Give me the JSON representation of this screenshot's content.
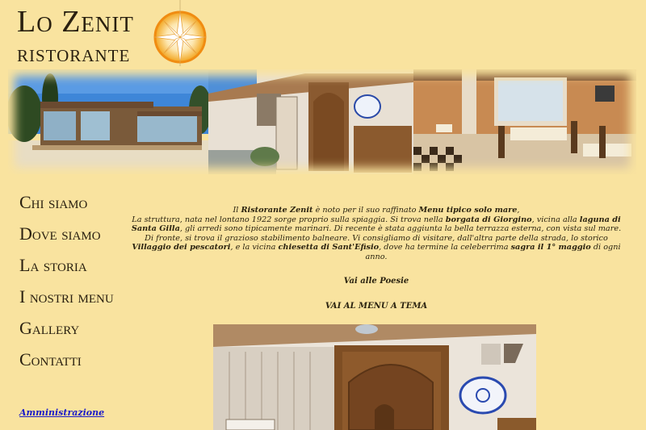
{
  "logo": {
    "line1": "Lo Zenit",
    "line2": "ristorante",
    "compass_icon": "compass-rose-icon"
  },
  "nav": {
    "items": [
      {
        "label": "Chi siamo"
      },
      {
        "label": "Dove siamo"
      },
      {
        "label": "La storia"
      },
      {
        "label": "I nostri menu"
      },
      {
        "label": "Gallery"
      },
      {
        "label": "Contatti"
      }
    ],
    "admin_label": "Amministrazione"
  },
  "content": {
    "p1_a": "Il ",
    "p1_name": "Ristorante Zenit",
    "p1_b": " è noto per il suo raffinato ",
    "p1_menu": "Menu tipico solo mare",
    "p1_c": ",",
    "p2_a": "La struttura, nata nel lontano 1922 sorge proprio sulla spiaggia. Si trova nella ",
    "p2_borgata": "borgata di Giorgino",
    "p2_b": ", vicina alla ",
    "p2_laguna": "laguna di Santa Gilla",
    "p2_c": ", gli arredi sono tipicamente marinari. Di recente è stata aggiunta la bella terrazza esterna, con vista sul mare.",
    "p3_a": "Di fronte, si trova il grazioso stabilimento balneare. Vi consigliamo di visitare, dall'altra parte della strada, lo storico ",
    "p3_villaggio": "Villaggio dei pescatori",
    "p3_b": ", e la vicina ",
    "p3_chiesetta": "chiesetta di Sant'Efisio",
    "p3_c": ", dove ha termine la celeberrima ",
    "p3_sagra": "sagra il 1° maggio",
    "p3_d": " di ogni anno.",
    "poesie_link": "Vai alle Poesie",
    "menu_tema_link": "VAI AL MENU A TEMA"
  },
  "colors": {
    "background": "#f9e39f",
    "link": "#1a1ac9",
    "text": "#2b2310"
  }
}
